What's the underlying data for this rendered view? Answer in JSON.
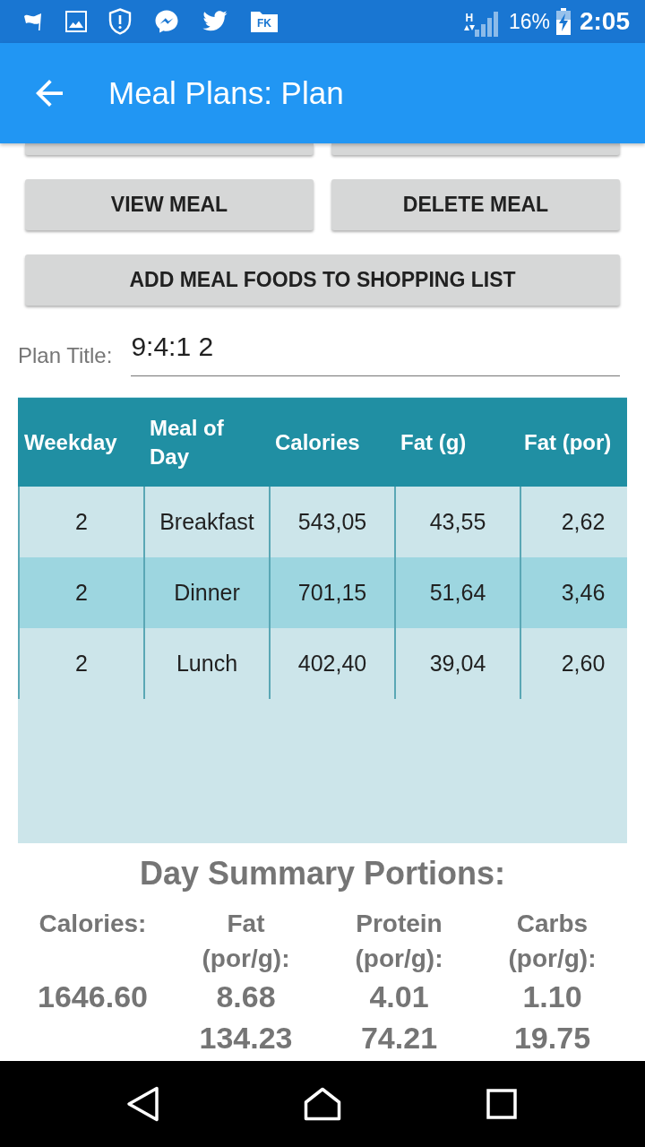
{
  "status_bar": {
    "folder_badge": "FK",
    "network_type": "H",
    "battery": "16%",
    "time": "2:05"
  },
  "app_bar": {
    "title": "Meal Plans: Plan"
  },
  "buttons": [
    {
      "kind": "cut_off"
    },
    {
      "kind": "cut_off"
    },
    {
      "kind": "half",
      "label": "VIEW MEAL"
    },
    {
      "kind": "half",
      "label": "DELETE MEAL"
    },
    {
      "kind": "full",
      "label": "ADD MEAL FOODS TO SHOPPING LIST"
    }
  ],
  "plan_title": {
    "label": "Plan Title:",
    "value": "9:4:1 2"
  },
  "table": {
    "columns": [
      "Weekday",
      "Meal of Day",
      "Calories",
      "Fat (g)",
      "Fat (por)"
    ],
    "rows": [
      [
        "2",
        "Breakfast",
        "543,05",
        "43,55",
        "2,62"
      ],
      [
        "2",
        "Dinner",
        "701,15",
        "51,64",
        "3,46"
      ],
      [
        "2",
        "Lunch",
        "402,40",
        "39,04",
        "2,60"
      ]
    ]
  },
  "day_summary": {
    "title": "Day Summary Portions:",
    "columns": [
      {
        "label": "Calories:",
        "values": [
          "1646.60"
        ]
      },
      {
        "label": "Fat (por/g):",
        "values": [
          "8.68",
          "134.23"
        ]
      },
      {
        "label": "Protein (por/g):",
        "values": [
          "4.01",
          "74.21"
        ]
      },
      {
        "label": "Carbs (por/g):",
        "values": [
          "1.10",
          "19.75"
        ]
      }
    ]
  }
}
